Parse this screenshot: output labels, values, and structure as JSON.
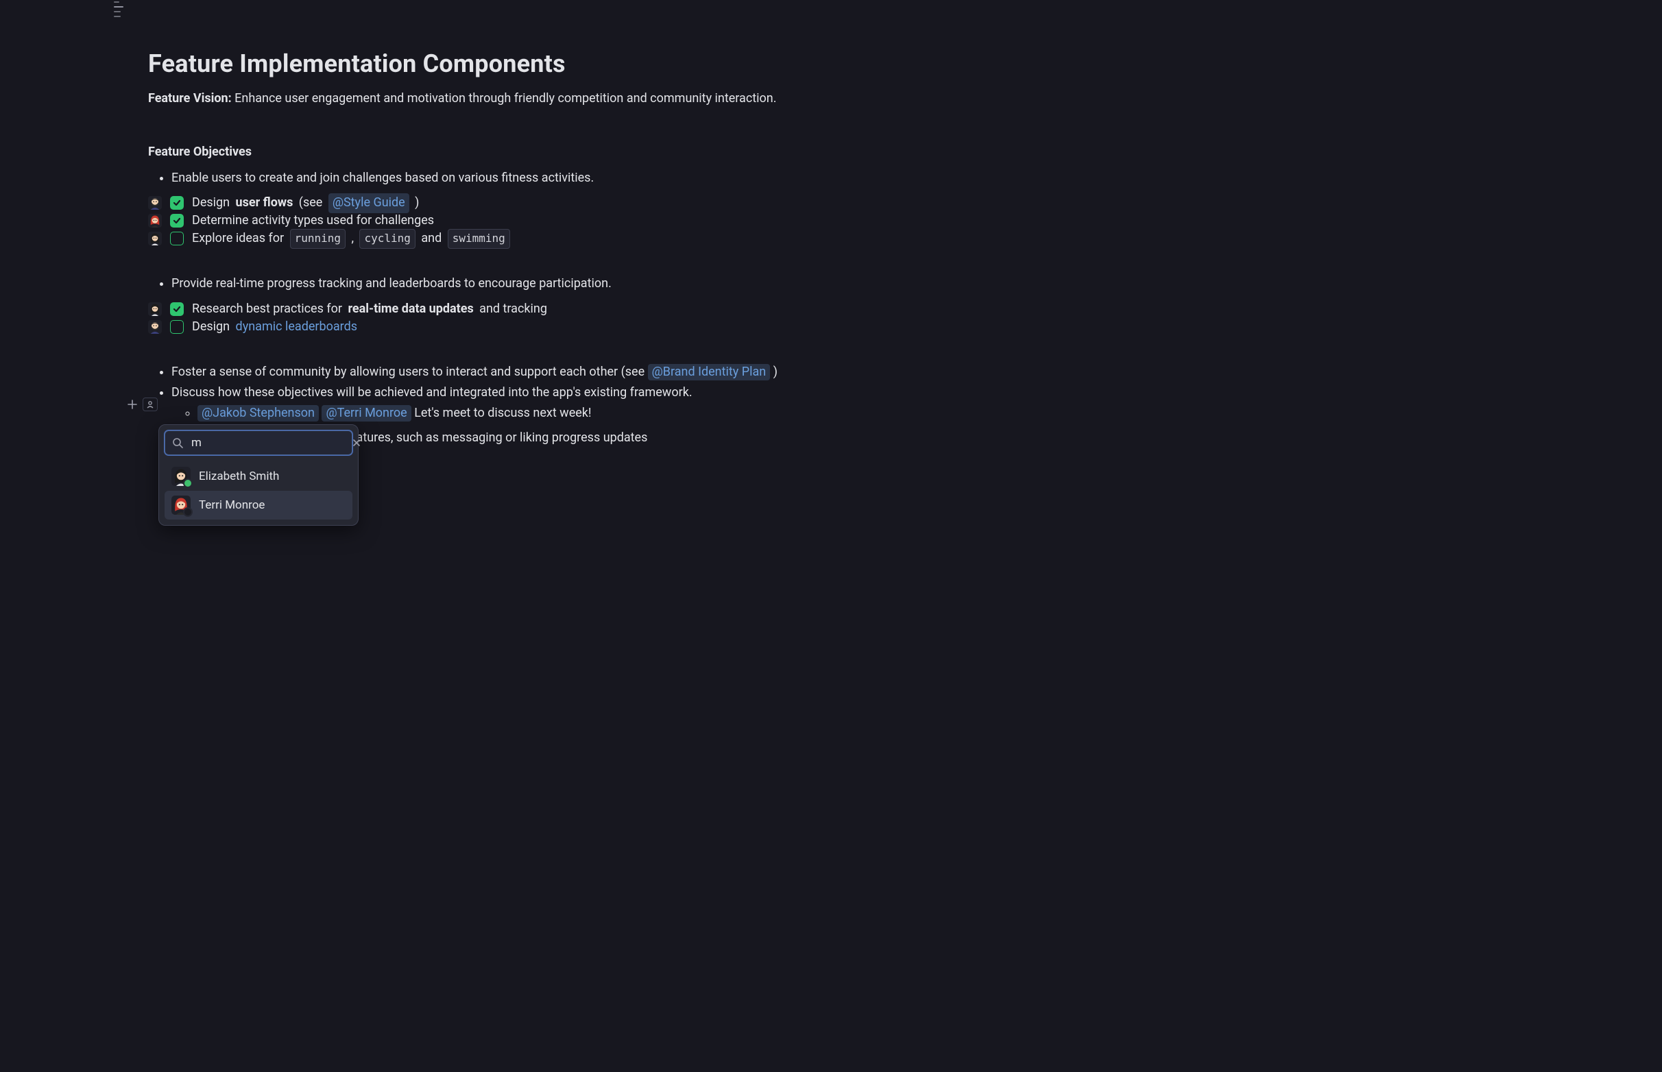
{
  "title": "Feature Implementation Components",
  "vision_label": "Feature Vision:",
  "vision_text": " Enhance user engagement and motivation through friendly competition and community interaction.",
  "objectives_heading": "Feature Objectives",
  "obj1": {
    "bullet": "Enable users to create and join challenges based on various fitness activities.",
    "t1_prefix": "Design ",
    "t1_bold": "user flows",
    "t1_suffix": " (see ",
    "t1_mention": "@Style Guide",
    "t1_close": " )",
    "t2": "Determine activity types used for challenges",
    "t3_prefix": "Explore ideas for ",
    "t3_code1": "running",
    "t3_mid1": " , ",
    "t3_code2": "cycling",
    "t3_mid2": " and ",
    "t3_code3": "swimming"
  },
  "obj2": {
    "bullet": "Provide real-time progress tracking and leaderboards to encourage participation.",
    "t1_prefix": "Research best practices for ",
    "t1_bold": "real-time data updates",
    "t1_suffix": " and tracking",
    "t2_prefix": "Design ",
    "t2_link": "dynamic leaderboards"
  },
  "obj3": {
    "bullet_prefix": "Foster a sense of community by allowing users to interact and support each other (see ",
    "bullet_mention": "@Brand Identity Plan",
    "bullet_suffix": " )",
    "bullet2": "Discuss how these objectives will be achieved and integrated into the app's existing framework.",
    "nested_m1": "@Jakob Stephenson",
    "nested_m2": "@Terri Monroe",
    "nested_text": " Let's meet to discuss next week!",
    "task": "Plan community interaction features, such as messaging or liking progress updates"
  },
  "popup": {
    "search_value": "m",
    "item1": "Elizabeth Smith",
    "item2": "Terri Monroe"
  }
}
